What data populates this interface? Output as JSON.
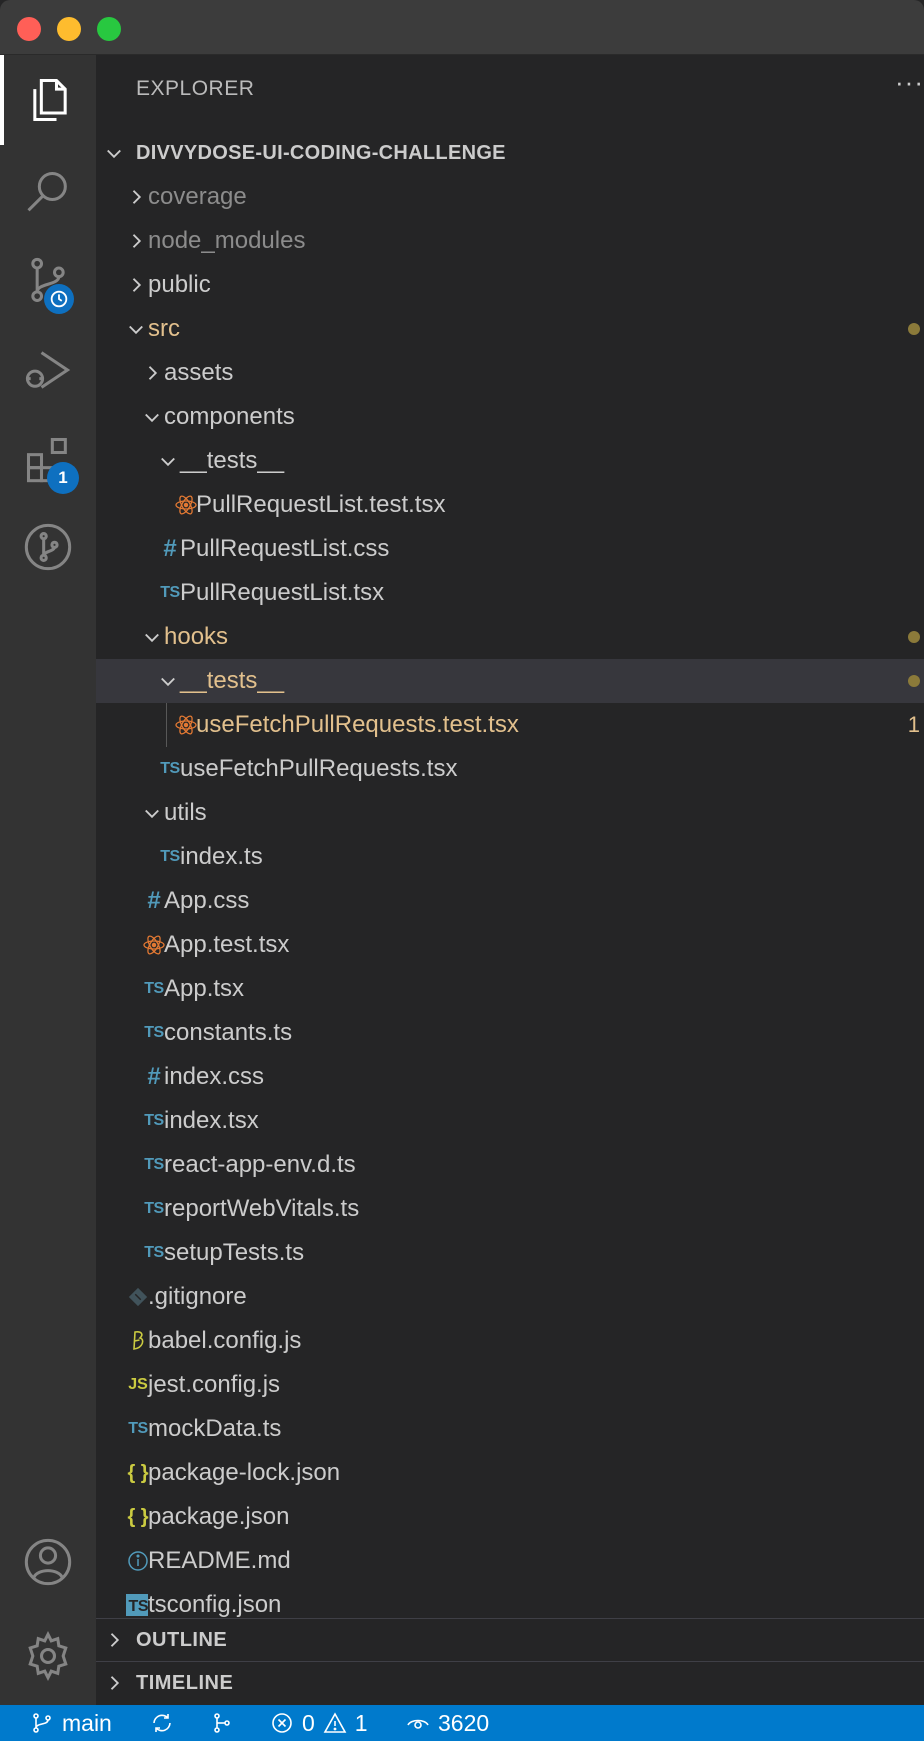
{
  "explorer": {
    "title": "EXPLORER",
    "more": "···",
    "root": "DIVVYDOSE-UI-CODING-CHALLENGE"
  },
  "activity": {
    "extensions_badge": "1"
  },
  "tree": [
    {
      "label": "coverage",
      "level": 0,
      "kind": "folder",
      "open": false,
      "dim": true
    },
    {
      "label": "node_modules",
      "level": 0,
      "kind": "folder",
      "open": false,
      "dim": true
    },
    {
      "label": "public",
      "level": 0,
      "kind": "folder",
      "open": false
    },
    {
      "label": "src",
      "level": 0,
      "kind": "folder",
      "open": true,
      "mod": true,
      "dot": true
    },
    {
      "label": "assets",
      "level": 1,
      "kind": "folder",
      "open": false
    },
    {
      "label": "components",
      "level": 1,
      "kind": "folder",
      "open": true
    },
    {
      "label": "__tests__",
      "level": 2,
      "kind": "folder",
      "open": true
    },
    {
      "label": "PullRequestList.test.tsx",
      "level": 3,
      "kind": "react"
    },
    {
      "label": "PullRequestList.css",
      "level": 2,
      "kind": "css"
    },
    {
      "label": "PullRequestList.tsx",
      "level": 2,
      "kind": "ts"
    },
    {
      "label": "hooks",
      "level": 1,
      "kind": "folder",
      "open": true,
      "mod": true,
      "dot": true
    },
    {
      "label": "__tests__",
      "level": 2,
      "kind": "folder",
      "open": true,
      "mod": true,
      "dot": true,
      "selected": true
    },
    {
      "label": "useFetchPullRequests.test.tsx",
      "level": 3,
      "kind": "react",
      "mod": true,
      "count": "1",
      "guide": true
    },
    {
      "label": "useFetchPullRequests.tsx",
      "level": 2,
      "kind": "ts"
    },
    {
      "label": "utils",
      "level": 1,
      "kind": "folder",
      "open": true
    },
    {
      "label": "index.ts",
      "level": 2,
      "kind": "ts"
    },
    {
      "label": "App.css",
      "level": 1,
      "kind": "css"
    },
    {
      "label": "App.test.tsx",
      "level": 1,
      "kind": "react"
    },
    {
      "label": "App.tsx",
      "level": 1,
      "kind": "ts"
    },
    {
      "label": "constants.ts",
      "level": 1,
      "kind": "ts"
    },
    {
      "label": "index.css",
      "level": 1,
      "kind": "css"
    },
    {
      "label": "index.tsx",
      "level": 1,
      "kind": "ts"
    },
    {
      "label": "react-app-env.d.ts",
      "level": 1,
      "kind": "ts"
    },
    {
      "label": "reportWebVitals.ts",
      "level": 1,
      "kind": "ts"
    },
    {
      "label": "setupTests.ts",
      "level": 1,
      "kind": "ts"
    },
    {
      "label": ".gitignore",
      "level": 0,
      "kind": "git"
    },
    {
      "label": "babel.config.js",
      "level": 0,
      "kind": "babel"
    },
    {
      "label": "jest.config.js",
      "level": 0,
      "kind": "js"
    },
    {
      "label": "mockData.ts",
      "level": 0,
      "kind": "ts"
    },
    {
      "label": "package-lock.json",
      "level": 0,
      "kind": "json"
    },
    {
      "label": "package.json",
      "level": 0,
      "kind": "json"
    },
    {
      "label": "README.md",
      "level": 0,
      "kind": "info"
    },
    {
      "label": "tsconfig.json",
      "level": 0,
      "kind": "tsconfig"
    }
  ],
  "sections": {
    "outline": "OUTLINE",
    "timeline": "TIMELINE"
  },
  "status": {
    "branch": "main",
    "errors": "0",
    "warnings": "1",
    "watchers": "3620"
  },
  "icons": {
    "ts_text": "TS",
    "js_text": "JS",
    "css_text": "#",
    "json_text": "{ }"
  },
  "colors": {
    "accent": "#007acc",
    "modified": "#e2c08d",
    "ts_blue": "#519aba",
    "js_yellow": "#cbcb41",
    "react_orange": "#e37933"
  }
}
